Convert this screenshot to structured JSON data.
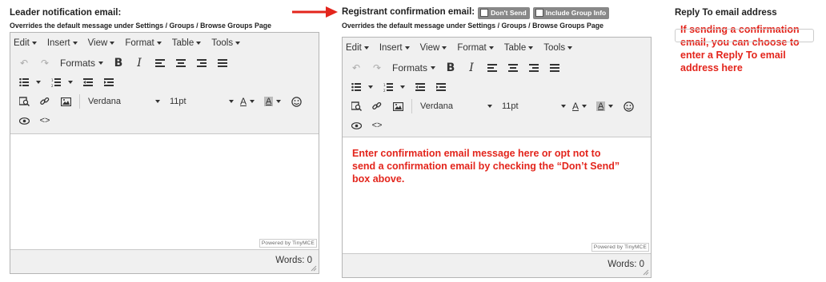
{
  "leader": {
    "label": "Leader notification email:",
    "sub": "Overrides the default message under Settings / Groups / Browse Groups Page",
    "editor": {
      "words": "Words: 0"
    }
  },
  "registrant": {
    "label": "Registrant confirmation email:",
    "checkbox_dont_send": "Don't Send",
    "checkbox_include_group": "Include Group Info",
    "sub": "Overrides the default message under Settings / Groups / Browse Groups Page",
    "annotation": "Enter confirmation email message here or opt not to send a confirmation email by checking the “Don’t Send” box above.",
    "editor": {
      "words": "Words: 0"
    }
  },
  "reply_to": {
    "label": "Reply To email address",
    "value": "",
    "annotation": "If sending a confirmation email, you can choose to enter a Reply To email address here"
  },
  "editor_common": {
    "menus": [
      "Edit",
      "Insert",
      "View",
      "Format",
      "Table",
      "Tools"
    ],
    "formats_label": "Formats",
    "font_family": "Verdana",
    "font_size": "11pt",
    "text_color_letter": "A",
    "bg_color_letter": "A",
    "powered_by": "Powered by TinyMCE"
  },
  "colors": {
    "annotation_red": "#e3251c",
    "toolbar_bg": "#f0f0f0",
    "checkbox_bg": "#888888"
  },
  "icons": [
    "undo-icon",
    "redo-icon",
    "bold-icon",
    "italic-icon",
    "align-left-icon",
    "align-center-icon",
    "align-right-icon",
    "align-justify-icon",
    "bullet-list-icon",
    "numbered-list-icon",
    "outdent-icon",
    "indent-icon",
    "search-replace-icon",
    "link-icon",
    "image-icon",
    "text-color-icon",
    "background-color-icon",
    "emoticon-icon",
    "preview-icon",
    "code-icon",
    "arrow-icon",
    "resize-grip-icon"
  ]
}
